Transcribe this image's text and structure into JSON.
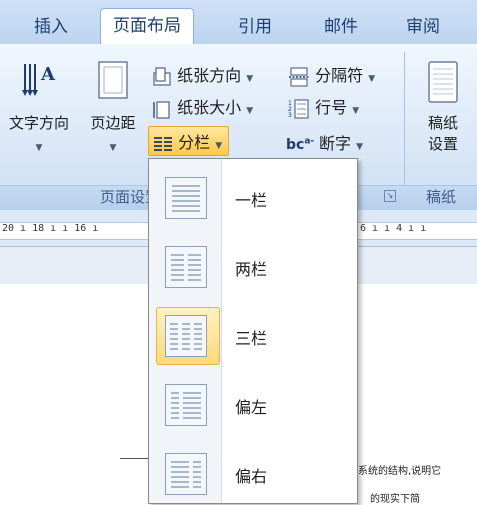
{
  "tabs": [
    "插入",
    "页面布局",
    "引用",
    "邮件",
    "审阅"
  ],
  "active_tab": "页面布局",
  "ribbon": {
    "big_buttons": {
      "text_direction": "文字方向",
      "margins": "页边距"
    },
    "small_buttons": {
      "orientation": "纸张方向",
      "size": "纸张大小",
      "columns": "分栏",
      "breaks": "分隔符",
      "line_numbers": "行号",
      "hyphenation": "断字",
      "hyphen_icon_text": "bc",
      "hyphen_icon_sup": "a-"
    },
    "group_labels": {
      "page_setup": "页面设置",
      "draft": "稿纸"
    },
    "draft_button": [
      "稿纸",
      "设置"
    ]
  },
  "ruler_text": {
    "left": "20 ı 18 ı ı 16 ı",
    "right": "6 ı ı 4 ı ı"
  },
  "columns_menu": {
    "items": [
      {
        "label": "一栏",
        "selected": false
      },
      {
        "label": "两栏",
        "selected": false
      },
      {
        "label": "三栏",
        "selected": true
      },
      {
        "label": "偏左",
        "selected": false
      },
      {
        "label": "偏右",
        "selected": false
      }
    ]
  },
  "document": {
    "line1": "系统的结构,说明它",
    "line2": "的现实下简"
  },
  "colors": {
    "accent_selected": "#ffd97a",
    "ribbon_blue": "#dbe8f7",
    "columns_highlight": "#ffd55a"
  }
}
